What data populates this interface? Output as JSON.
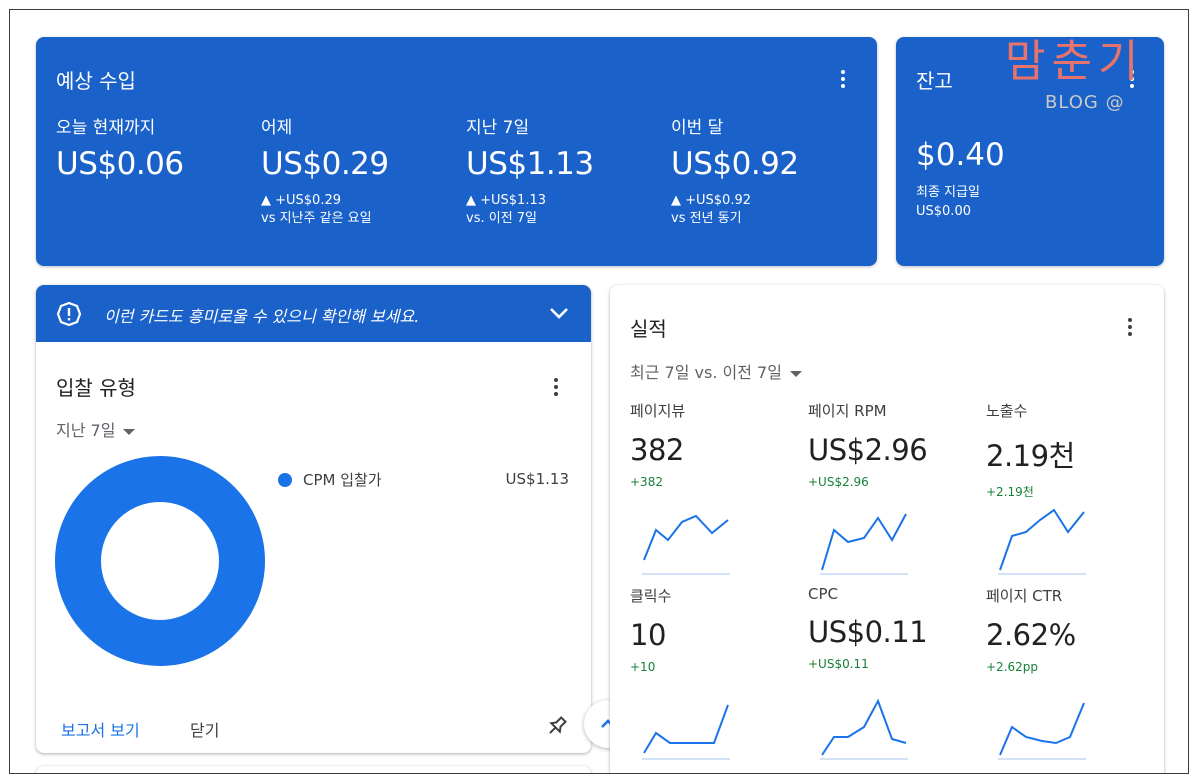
{
  "estimated_earnings": {
    "title": "예상 수입",
    "metrics": [
      {
        "label": "오늘 현재까지",
        "value": "US$0.06",
        "delta": "",
        "compare": ""
      },
      {
        "label": "어제",
        "value": "US$0.29",
        "delta": "▲ +US$0.29",
        "compare": "vs 지난주 같은 요일"
      },
      {
        "label": "지난 7일",
        "value": "US$1.13",
        "delta": "▲ +US$1.13",
        "compare": "vs. 이전 7일"
      },
      {
        "label": "이번 달",
        "value": "US$0.92",
        "delta": "▲ +US$0.92",
        "compare": "vs 전년 동기"
      }
    ]
  },
  "balance": {
    "title": "잔고",
    "amount": "$0.40",
    "last_payment_label": "최종 지급일",
    "last_payment_value": "US$0.00"
  },
  "watermark": {
    "title": "맘춘기",
    "subtitle": "BLOG @"
  },
  "bidding": {
    "banner_text": "이런 카드도 흥미로울 수 있으니 확인해 보세요.",
    "title": "입찰 유형",
    "range": "지난 7일",
    "legend": [
      {
        "label": "CPM 입찰가",
        "value": "US$1.13",
        "color": "#1a73e8",
        "share": 1.0
      }
    ],
    "report_link": "보고서 보기",
    "close_label": "닫기"
  },
  "performance": {
    "title": "실적",
    "range": "최근 7일 vs. 이전 7일",
    "tiles": [
      {
        "label": "페이지뷰",
        "value": "382",
        "delta": "+382"
      },
      {
        "label": "페이지 RPM",
        "value": "US$2.96",
        "delta": "+US$2.96"
      },
      {
        "label": "노출수",
        "value": "2.19천",
        "delta": "+2.19천"
      },
      {
        "label": "클릭수",
        "value": "10",
        "delta": "+10"
      },
      {
        "label": "CPC",
        "value": "US$0.11",
        "delta": "+US$0.11"
      },
      {
        "label": "페이지 CTR",
        "value": "2.62%",
        "delta": "+2.62pp"
      }
    ]
  },
  "colors": {
    "primary_blue": "#1a62c9",
    "accent_blue": "#1a73e8",
    "positive_green": "#188038",
    "watermark_red": "#e8736b"
  }
}
